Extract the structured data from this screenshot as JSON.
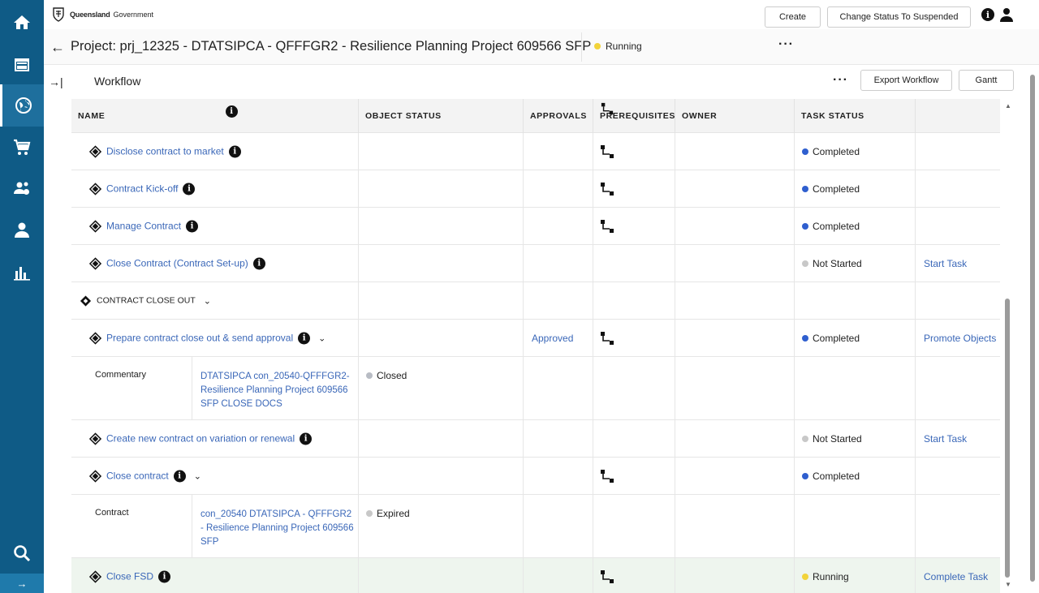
{
  "nav": {
    "items": [
      {
        "icon": "home-icon"
      },
      {
        "icon": "dashboard-icon"
      },
      {
        "icon": "globe-projects-icon",
        "active": true
      },
      {
        "icon": "cart-icon"
      },
      {
        "icon": "suppliers-icon"
      },
      {
        "icon": "user-icon"
      },
      {
        "icon": "reports-icon"
      }
    ],
    "search_icon": "search-icon",
    "expand_glyph": "→"
  },
  "topbar": {
    "brand_bold": "Queensland",
    "brand_regular": "Government",
    "info_glyph": "i"
  },
  "project": {
    "title": "Project: prj_12325 - DTATSIPCA - QFFFGR2 - Resilience Planning Project 609566 SFP",
    "status": "Running",
    "status_color": "#f2d33a",
    "more_glyph": "···",
    "create_label": "Create",
    "suspend_label": "Change Status To Suspended"
  },
  "workflow": {
    "title": "Workflow",
    "more_glyph": "···",
    "export_label": "Export Workflow",
    "gantt_label": "Gantt"
  },
  "table": {
    "columns": [
      "NAME",
      "OBJECT STATUS",
      "APPROVALS",
      "PREREQUISITES",
      "OWNER",
      "TASK STATUS"
    ],
    "status_colors": {
      "Completed": "#2f5fcf",
      "Not Started": "#c8c8c8",
      "Running": "#f2d33a",
      "Closed": "#b8bcc4",
      "Expired": "#c8c8c8"
    },
    "rows": [
      {
        "name": "Disclose contract to market",
        "prereq": true,
        "status": "Completed",
        "action": ""
      },
      {
        "name": "Contract Kick-off",
        "prereq": true,
        "status": "Completed",
        "action": ""
      },
      {
        "name": "Manage Contract",
        "prereq": true,
        "status": "Completed",
        "action": ""
      },
      {
        "name": "Close Contract (Contract Set-up)",
        "prereq": false,
        "status": "Not Started",
        "action": "Start Task"
      },
      {
        "section": "CONTRACT CLOSE OUT"
      },
      {
        "name": "Prepare contract close out & send approval",
        "approval": "Approved",
        "prereq": true,
        "status": "Completed",
        "action": "Promote Objects"
      },
      {
        "sub_label": "Commentary",
        "sub_link": "DTATSIPCA con_20540-QFFFGR2-Resilience Planning Project 609566 SFP CLOSE DOCS",
        "sub_status": "Closed"
      },
      {
        "name": "Create new contract on variation or renewal",
        "prereq": false,
        "status": "Not Started",
        "action": "Start Task"
      },
      {
        "name": "Close contract",
        "prereq": true,
        "status": "Completed",
        "action": ""
      },
      {
        "sub_label": "Contract",
        "sub_link": "con_20540 DTATSIPCA - QFFFGR2 - Resilience Planning Project 609566 SFP",
        "sub_status": "Expired"
      },
      {
        "name": "Close FSD",
        "prereq": true,
        "status": "Running",
        "action": "Complete Task"
      }
    ]
  }
}
